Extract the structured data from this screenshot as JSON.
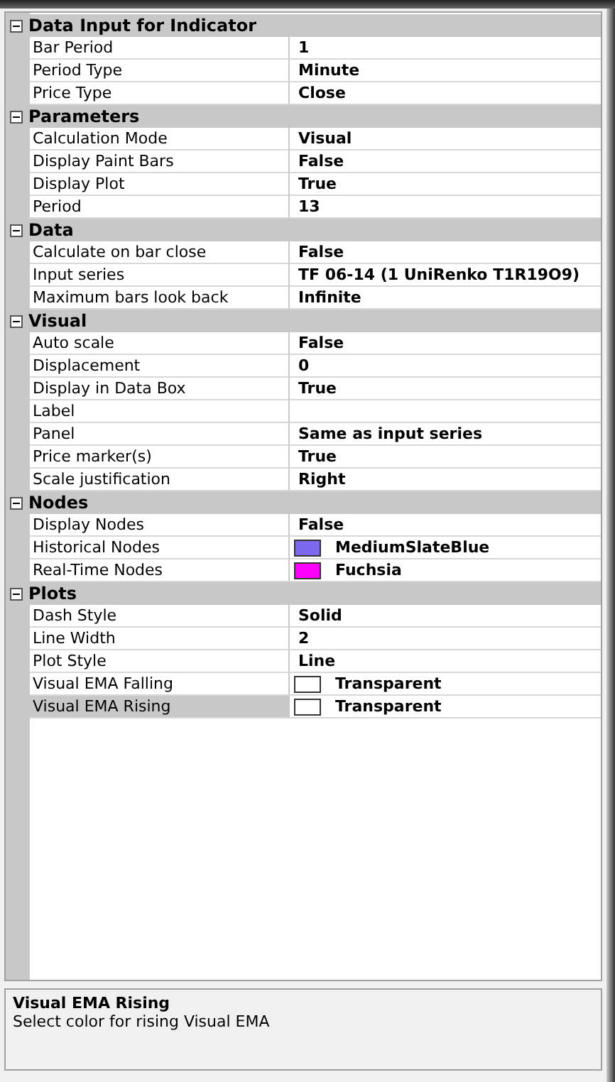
{
  "categories": [
    {
      "name": "Data Input for Indicator",
      "expanded": true,
      "properties": [
        {
          "name": "Bar Period",
          "value": "1",
          "selected": false
        },
        {
          "name": "Period Type",
          "value": "Minute",
          "selected": false
        },
        {
          "name": "Price Type",
          "value": "Close",
          "selected": false
        }
      ]
    },
    {
      "name": "Parameters",
      "expanded": true,
      "properties": [
        {
          "name": "Calculation Mode",
          "value": "Visual",
          "selected": false
        },
        {
          "name": "Display Paint Bars",
          "value": "False",
          "selected": false
        },
        {
          "name": "Display Plot",
          "value": "True",
          "selected": false
        },
        {
          "name": "Period",
          "value": "13",
          "selected": false
        }
      ]
    },
    {
      "name": "Data",
      "expanded": true,
      "properties": [
        {
          "name": "Calculate on bar close",
          "value": "False",
          "selected": false
        },
        {
          "name": "Input series",
          "value": "TF 06-14 (1 UniRenko T1R19O9)",
          "selected": false
        },
        {
          "name": "Maximum bars look back",
          "value": "Infinite",
          "selected": false
        }
      ]
    },
    {
      "name": "Visual",
      "expanded": true,
      "properties": [
        {
          "name": "Auto scale",
          "value": "False",
          "selected": false
        },
        {
          "name": "Displacement",
          "value": "0",
          "selected": false
        },
        {
          "name": "Display in Data Box",
          "value": "True",
          "selected": false
        },
        {
          "name": "Label",
          "selected": false
        },
        {
          "name": "Panel",
          "value": "Same as input series",
          "selected": false
        },
        {
          "name": "Price marker(s)",
          "value": "True",
          "selected": false
        },
        {
          "name": "Scale justification",
          "value": "Right",
          "selected": false
        }
      ]
    },
    {
      "name": "Nodes",
      "expanded": true,
      "properties": [
        {
          "name": "Display Nodes",
          "value": "False",
          "selected": false
        },
        {
          "name": "Historical Nodes",
          "value": "MediumSlateBlue",
          "selected": false,
          "color": "#7b68ee"
        },
        {
          "name": "Real-Time Nodes",
          "value": "Fuchsia",
          "selected": false,
          "color": "#ff00ff"
        }
      ]
    },
    {
      "name": "Plots",
      "expanded": true,
      "properties": [
        {
          "name": "Dash Style",
          "value": "Solid",
          "selected": false
        },
        {
          "name": "Line Width",
          "value": "2",
          "selected": false
        },
        {
          "name": "Plot Style",
          "value": "Line",
          "selected": false
        },
        {
          "name": "Visual EMA Falling",
          "value": "Transparent",
          "selected": false,
          "color": "#ffffff"
        },
        {
          "name": "Visual EMA Rising",
          "value": "Transparent",
          "selected": true,
          "color": "#ffffff"
        }
      ]
    }
  ],
  "description": {
    "title": "Visual EMA Rising",
    "text": "Select color for rising Visual EMA"
  }
}
